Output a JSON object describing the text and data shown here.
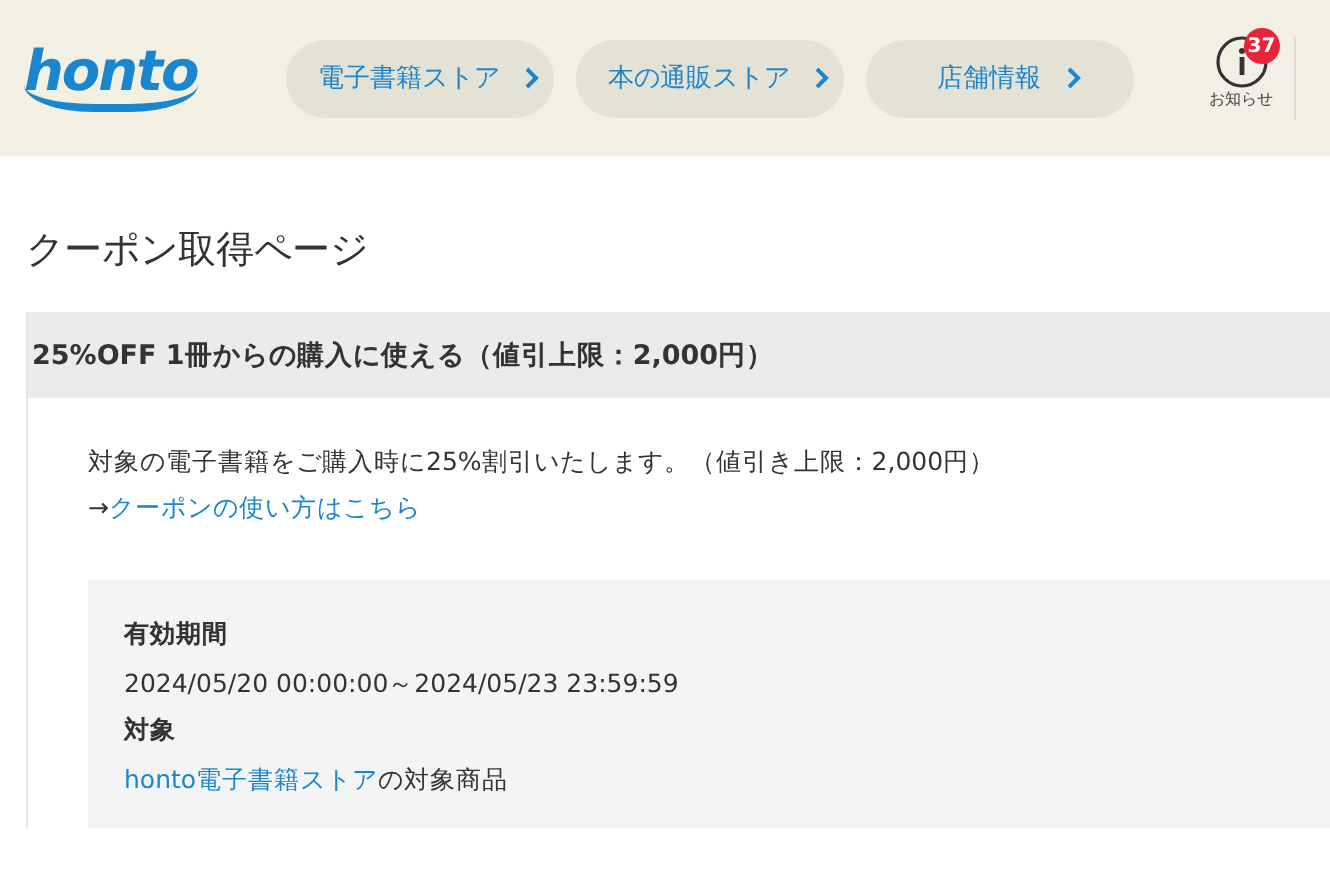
{
  "header": {
    "logo": "honto",
    "nav": [
      {
        "label": "電子書籍ストア"
      },
      {
        "label": "本の通販ストア"
      },
      {
        "label": "店舗情報"
      }
    ],
    "notice": {
      "label": "お知らせ",
      "badge": "37"
    }
  },
  "page_title": "クーポン取得ページ",
  "coupon": {
    "heading": "25%OFF 1冊からの購入に使える（値引上限：2,000円）",
    "description": "対象の電子書籍をご購入時に25%割引いたします。（値引き上限：2,000円）",
    "guide_arrow": "→",
    "guide_link": "クーポンの使い方はこちら",
    "details": [
      {
        "label": "有効期間",
        "value": "2024/05/20 00:00:00～2024/05/23 23:59:59"
      },
      {
        "label": "対象",
        "link": "honto電子書籍ストア",
        "value": "の対象商品"
      }
    ]
  }
}
